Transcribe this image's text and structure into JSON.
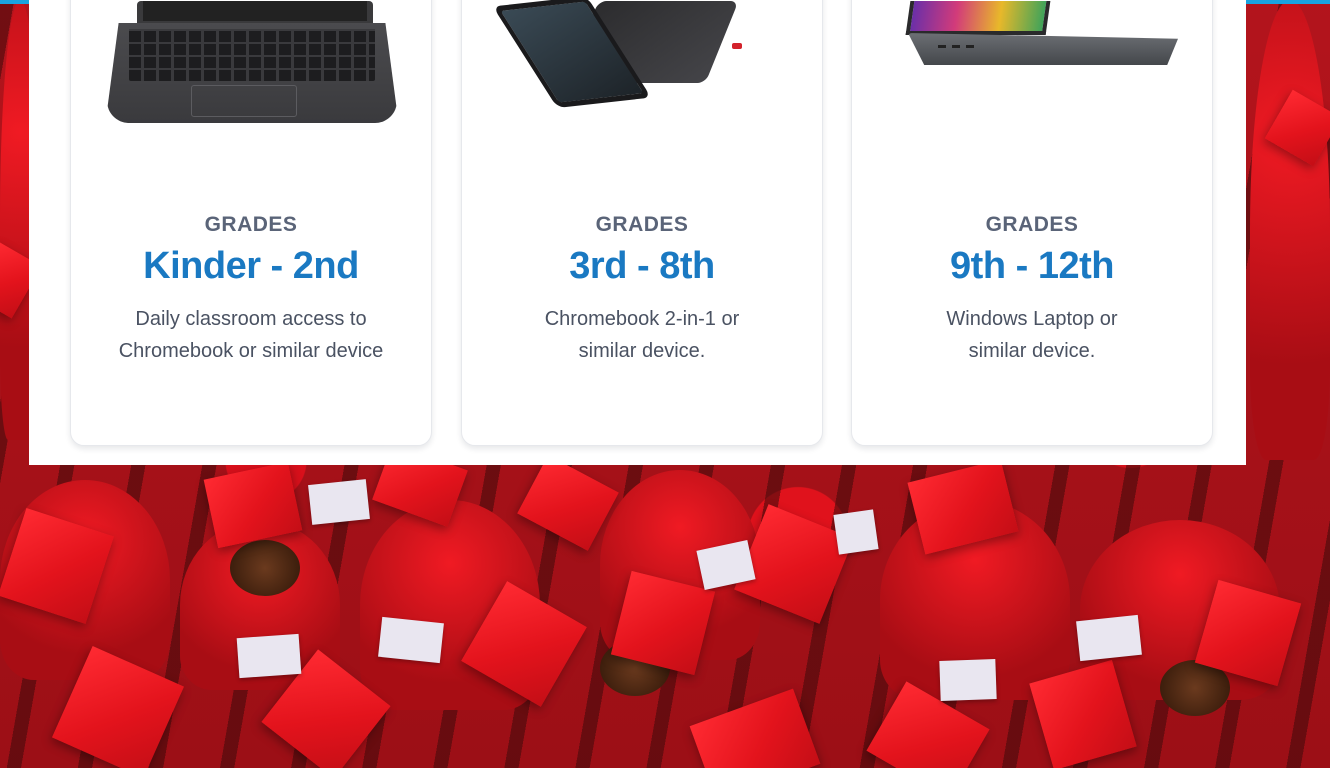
{
  "cards": [
    {
      "grades_label": "GRADES",
      "range": "Kinder - 2nd",
      "description": "Daily classroom access to Chromebook or similar device",
      "device_icon": "chromebook-laptop-icon"
    },
    {
      "grades_label": "GRADES",
      "range": "3rd - 8th",
      "description": "Chromebook 2-in-1 or similar device.",
      "device_icon": "chromebook-2in1-icon"
    },
    {
      "grades_label": "GRADES",
      "range": "9th - 12th",
      "description": "Windows Laptop or similar device.",
      "device_icon": "windows-laptop-icon"
    }
  ],
  "colors": {
    "accent_blue": "#1a79c2",
    "label_gray": "#5a6478",
    "top_bar": "#1aa3e0",
    "graduation_red": "#e3131c"
  }
}
